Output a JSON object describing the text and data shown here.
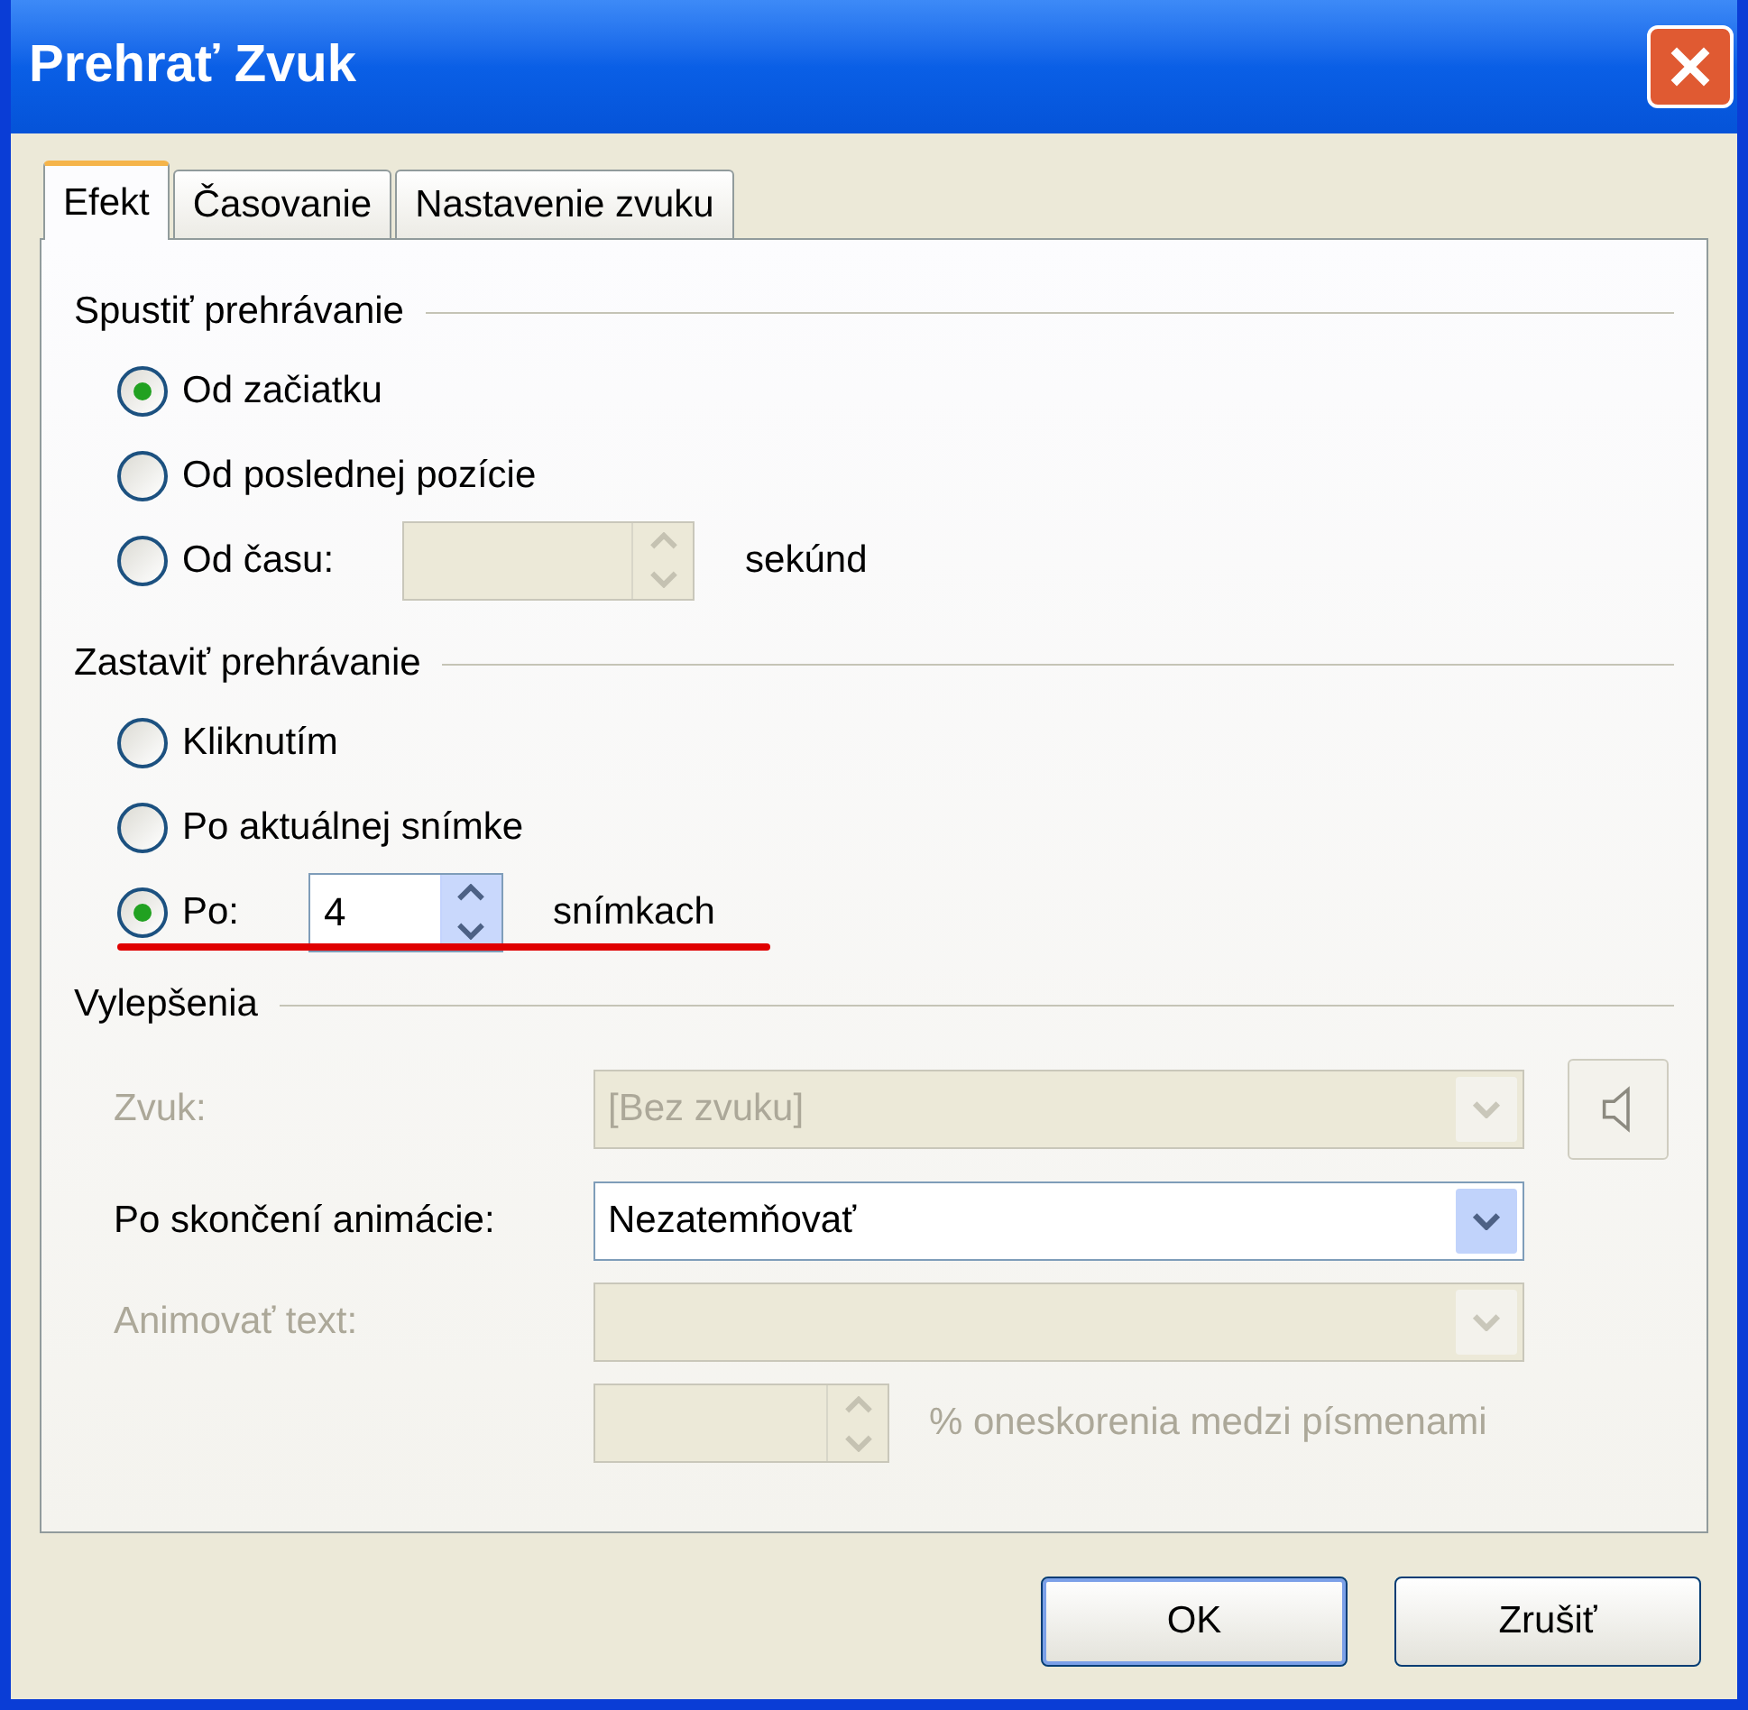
{
  "window": {
    "title": "Prehrať Zvuk"
  },
  "tabs": [
    {
      "label": "Efekt",
      "selected": true
    },
    {
      "label": "Časovanie",
      "selected": false
    },
    {
      "label": "Nastavenie zvuku",
      "selected": false
    }
  ],
  "start_group": {
    "title": "Spustiť prehrávanie",
    "options": [
      {
        "label": "Od začiatku",
        "selected": true
      },
      {
        "label": "Od poslednej pozície",
        "selected": false
      },
      {
        "label": "Od času:",
        "selected": false,
        "spinner": {
          "disabled": true
        },
        "unit": "sekúnd",
        "marked": false
      }
    ]
  },
  "stop_group": {
    "title": "Zastaviť prehrávanie",
    "options": [
      {
        "label": "Kliknutím",
        "selected": false
      },
      {
        "label": "Po aktuálnej snímke",
        "selected": false
      },
      {
        "label": "Po:",
        "selected": true,
        "spinner": {
          "value": "4",
          "disabled": false
        },
        "unit": "snímkach",
        "marked": true
      }
    ]
  },
  "enhancements": {
    "title": "Vylepšenia",
    "rows": [
      {
        "kind": "dropdown",
        "label": "Zvuk:",
        "value": "[Bez zvuku]",
        "disabled": true,
        "sound_button": true
      },
      {
        "kind": "dropdown",
        "label": "Po skončení animácie:",
        "value": "Nezatemňovať",
        "disabled": false,
        "sound_button": false
      },
      {
        "kind": "dropdown",
        "label": "Animovať text:",
        "disabled": true,
        "sound_button": false
      },
      {
        "kind": "spinner",
        "disabled": true,
        "suffix": "% oneskorenia medzi písmenami"
      }
    ]
  },
  "buttons": [
    {
      "label": "OK",
      "default": true
    },
    {
      "label": "Zrušiť",
      "default": false
    }
  ]
}
